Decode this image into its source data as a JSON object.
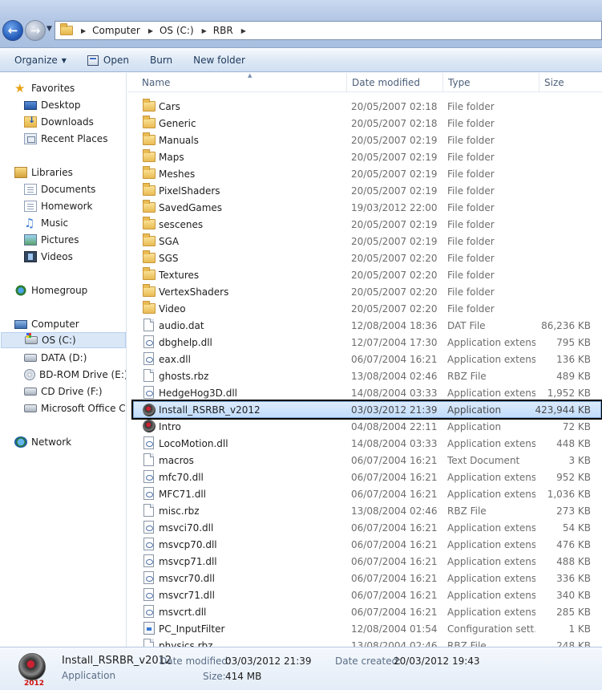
{
  "address_bar": {
    "breadcrumbs": [
      "Computer",
      "OS (C:)",
      "RBR"
    ]
  },
  "toolbar": {
    "organize": "Organize",
    "open": "Open",
    "burn": "Burn",
    "new_folder": "New folder"
  },
  "nav": {
    "favorites": "Favorites",
    "desktop": "Desktop",
    "downloads": "Downloads",
    "recent_places": "Recent Places",
    "libraries": "Libraries",
    "documents": "Documents",
    "homework": "Homework",
    "music": "Music",
    "pictures": "Pictures",
    "videos": "Videos",
    "homegroup": "Homegroup",
    "computer": "Computer",
    "os_c": "OS (C:)",
    "data_d": "DATA (D:)",
    "bdrom_e": "BD-ROM Drive (E:) T",
    "cd_f": "CD Drive (F:)",
    "ms_office": "Microsoft Office Clic",
    "network": "Network"
  },
  "columns": {
    "name": "Name",
    "date_modified": "Date modified",
    "type": "Type",
    "size": "Size"
  },
  "files": [
    {
      "name": "Cars",
      "date": "20/05/2007 02:18",
      "type": "File folder",
      "size": "",
      "icon": "folder"
    },
    {
      "name": "Generic",
      "date": "20/05/2007 02:18",
      "type": "File folder",
      "size": "",
      "icon": "folder"
    },
    {
      "name": "Manuals",
      "date": "20/05/2007 02:19",
      "type": "File folder",
      "size": "",
      "icon": "folder"
    },
    {
      "name": "Maps",
      "date": "20/05/2007 02:19",
      "type": "File folder",
      "size": "",
      "icon": "folder"
    },
    {
      "name": "Meshes",
      "date": "20/05/2007 02:19",
      "type": "File folder",
      "size": "",
      "icon": "folder"
    },
    {
      "name": "PixelShaders",
      "date": "20/05/2007 02:19",
      "type": "File folder",
      "size": "",
      "icon": "folder"
    },
    {
      "name": "SavedGames",
      "date": "19/03/2012 22:00",
      "type": "File folder",
      "size": "",
      "icon": "folder"
    },
    {
      "name": "sescenes",
      "date": "20/05/2007 02:19",
      "type": "File folder",
      "size": "",
      "icon": "folder"
    },
    {
      "name": "SGA",
      "date": "20/05/2007 02:19",
      "type": "File folder",
      "size": "",
      "icon": "folder"
    },
    {
      "name": "SGS",
      "date": "20/05/2007 02:20",
      "type": "File folder",
      "size": "",
      "icon": "folder"
    },
    {
      "name": "Textures",
      "date": "20/05/2007 02:20",
      "type": "File folder",
      "size": "",
      "icon": "folder"
    },
    {
      "name": "VertexShaders",
      "date": "20/05/2007 02:20",
      "type": "File folder",
      "size": "",
      "icon": "folder"
    },
    {
      "name": "Video",
      "date": "20/05/2007 02:20",
      "type": "File folder",
      "size": "",
      "icon": "folder"
    },
    {
      "name": "audio.dat",
      "date": "12/08/2004 18:36",
      "type": "DAT File",
      "size": "86,236 KB",
      "icon": "file"
    },
    {
      "name": "dbghelp.dll",
      "date": "12/07/2004 17:30",
      "type": "Application extens...",
      "size": "795 KB",
      "icon": "dll"
    },
    {
      "name": "eax.dll",
      "date": "06/07/2004 16:21",
      "type": "Application extens...",
      "size": "136 KB",
      "icon": "dll"
    },
    {
      "name": "ghosts.rbz",
      "date": "13/08/2004 02:46",
      "type": "RBZ File",
      "size": "489 KB",
      "icon": "file"
    },
    {
      "name": "HedgeHog3D.dll",
      "date": "14/08/2004 03:33",
      "type": "Application extens...",
      "size": "1,952 KB",
      "icon": "dll"
    },
    {
      "name": "Install_RSRBR_v2012",
      "date": "03/03/2012 21:39",
      "type": "Application",
      "size": "423,944 KB",
      "icon": "app"
    },
    {
      "name": "Intro",
      "date": "04/08/2004 22:11",
      "type": "Application",
      "size": "72 KB",
      "icon": "app"
    },
    {
      "name": "LocoMotion.dll",
      "date": "14/08/2004 03:33",
      "type": "Application extens...",
      "size": "448 KB",
      "icon": "dll"
    },
    {
      "name": "macros",
      "date": "06/07/2004 16:21",
      "type": "Text Document",
      "size": "3 KB",
      "icon": "file"
    },
    {
      "name": "mfc70.dll",
      "date": "06/07/2004 16:21",
      "type": "Application extens...",
      "size": "952 KB",
      "icon": "dll"
    },
    {
      "name": "MFC71.dll",
      "date": "06/07/2004 16:21",
      "type": "Application extens...",
      "size": "1,036 KB",
      "icon": "dll"
    },
    {
      "name": "misc.rbz",
      "date": "13/08/2004 02:46",
      "type": "RBZ File",
      "size": "273 KB",
      "icon": "file"
    },
    {
      "name": "msvci70.dll",
      "date": "06/07/2004 16:21",
      "type": "Application extens...",
      "size": "54 KB",
      "icon": "dll"
    },
    {
      "name": "msvcp70.dll",
      "date": "06/07/2004 16:21",
      "type": "Application extens...",
      "size": "476 KB",
      "icon": "dll"
    },
    {
      "name": "msvcp71.dll",
      "date": "06/07/2004 16:21",
      "type": "Application extens...",
      "size": "488 KB",
      "icon": "dll"
    },
    {
      "name": "msvcr70.dll",
      "date": "06/07/2004 16:21",
      "type": "Application extens...",
      "size": "336 KB",
      "icon": "dll"
    },
    {
      "name": "msvcr71.dll",
      "date": "06/07/2004 16:21",
      "type": "Application extens...",
      "size": "340 KB",
      "icon": "dll"
    },
    {
      "name": "msvcrt.dll",
      "date": "06/07/2004 16:21",
      "type": "Application extens...",
      "size": "285 KB",
      "icon": "dll"
    },
    {
      "name": "PC_InputFilter",
      "date": "12/08/2004 01:54",
      "type": "Configuration sett...",
      "size": "1 KB",
      "icon": "cfg"
    },
    {
      "name": "physics.rbz",
      "date": "13/08/2004 02:46",
      "type": "RBZ File",
      "size": "248 KB",
      "icon": "file"
    }
  ],
  "selected_index": 18,
  "details": {
    "name": "Install_RSRBR_v2012",
    "type": "Application",
    "date_modified_label": "Date modified:",
    "date_modified": "03/03/2012 21:39",
    "date_created_label": "Date created:",
    "date_created": "20/03/2012 19:43",
    "size_label": "Size:",
    "size": "414 MB",
    "icon_year": "2012"
  },
  "colors": {
    "selection_fill": "#c1dcfc",
    "selection_border": "#7da2ce",
    "secondary_text": "#6d6d6d"
  }
}
